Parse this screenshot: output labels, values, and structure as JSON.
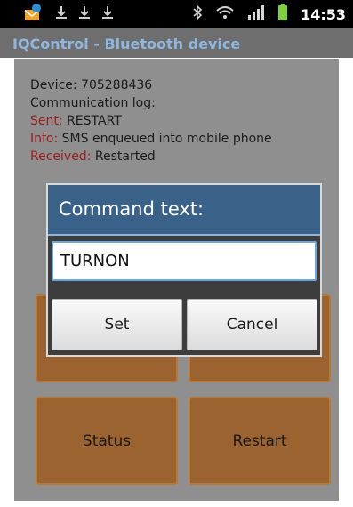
{
  "status_bar": {
    "time": "14:53",
    "left_icons": [
      "notification-app-icon",
      "download-icon",
      "download-icon",
      "download-icon"
    ],
    "right_icons": [
      "bluetooth-icon",
      "wifi-icon",
      "signal-icon",
      "battery-icon"
    ]
  },
  "app": {
    "title": "IQControl - Bluetooth device"
  },
  "log": {
    "device_label": "Device: 705288436",
    "comm_label": "Communication log:",
    "entries": [
      {
        "label": "Sent:",
        "text": " RESTART"
      },
      {
        "label": "Info:",
        "text": " SMS enqueued into mobile phone"
      },
      {
        "label": "Received:",
        "text": " Restarted"
      }
    ]
  },
  "grid_buttons": {
    "status": "Status",
    "restart": "Restart"
  },
  "dialog": {
    "title": "Command text:",
    "input_value": "TURNON",
    "set_label": "Set",
    "cancel_label": "Cancel"
  },
  "colors": {
    "status_bar": "#000000",
    "title_bar": "#6e6e6e",
    "title_text": "#8fb7de",
    "content_bg": "#8f8f8f",
    "log_label": "#9b1d1d",
    "grid_button": "#9a6330",
    "dialog_title": "#3a6288",
    "dialog_body": "#3d3d3d",
    "input_focus": "#6ba7e0"
  }
}
